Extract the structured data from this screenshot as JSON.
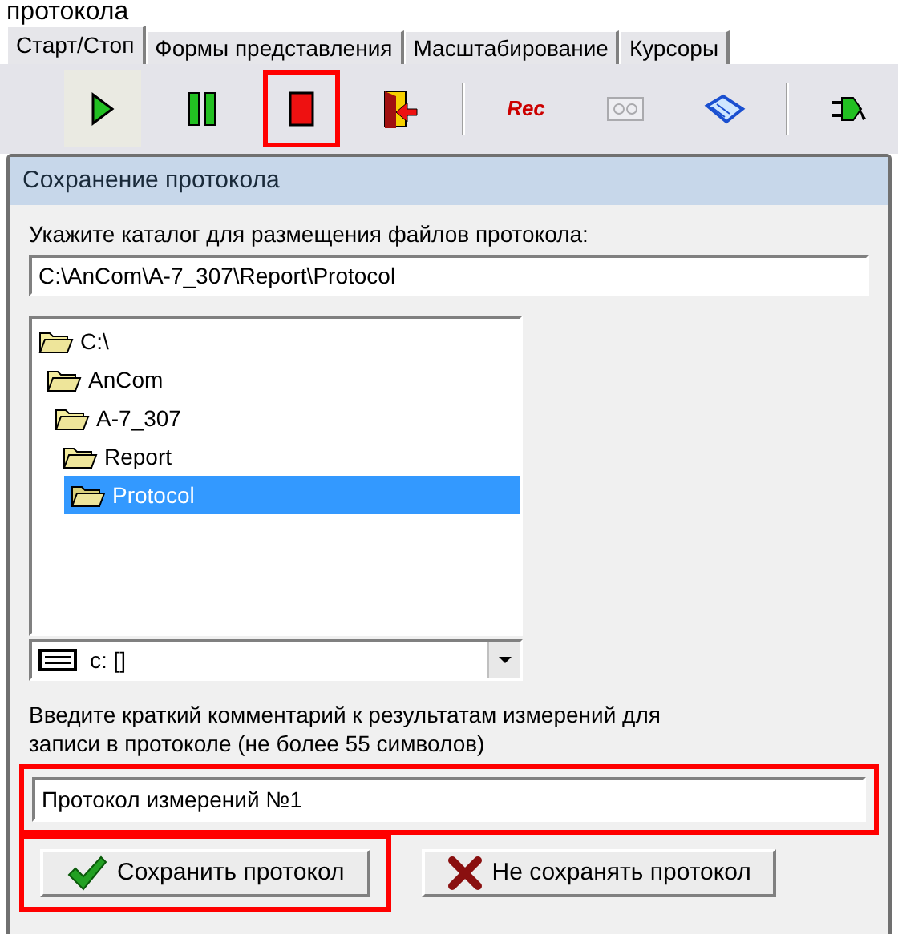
{
  "caption": "протокола",
  "tabs": [
    {
      "label": "Старт/Стоп",
      "selected": true
    },
    {
      "label": "Формы представления",
      "selected": false
    },
    {
      "label": "Масштабирование",
      "selected": false
    },
    {
      "label": "Курсоры",
      "selected": false
    }
  ],
  "toolbar": [
    {
      "kind": "play",
      "disabled": false,
      "highlighted": false
    },
    {
      "kind": "pause",
      "disabled": false,
      "highlighted": false
    },
    {
      "kind": "stop",
      "disabled": false,
      "highlighted": true
    },
    {
      "kind": "exit",
      "disabled": false,
      "highlighted": false
    },
    {
      "kind": "separator"
    },
    {
      "kind": "rec",
      "label": "Rec",
      "disabled": false,
      "highlighted": false
    },
    {
      "kind": "tape",
      "disabled": true,
      "highlighted": false
    },
    {
      "kind": "book",
      "disabled": false,
      "highlighted": false
    },
    {
      "kind": "separator"
    },
    {
      "kind": "plug",
      "disabled": false,
      "highlighted": false
    }
  ],
  "dialog": {
    "title": "Сохранение протокола",
    "folder_label": "Укажите каталог для размещения файлов протокола:",
    "folder_path": "C:\\AnCom\\A-7_307\\Report\\Protocol",
    "tree": [
      {
        "label": "C:\\",
        "selected": false,
        "children": [
          {
            "label": "AnCom",
            "selected": false,
            "children": [
              {
                "label": "A-7_307",
                "selected": false,
                "children": [
                  {
                    "label": "Report",
                    "selected": false,
                    "children": [
                      {
                        "label": "Protocol",
                        "selected": true
                      }
                    ]
                  }
                ]
              }
            ]
          }
        ]
      }
    ],
    "drive": "c: []",
    "comment_label": "Введите краткий комментарий к результатам измерений для записи в протоколе (не более 55 символов)",
    "comment": {
      "value": "Протокол измерений №1",
      "highlighted": true
    },
    "buttons": [
      {
        "kind": "save",
        "label": "Сохранить протокол",
        "highlighted": true
      },
      {
        "kind": "cancel",
        "label": "Не сохранять протокол",
        "highlighted": false
      }
    ]
  }
}
